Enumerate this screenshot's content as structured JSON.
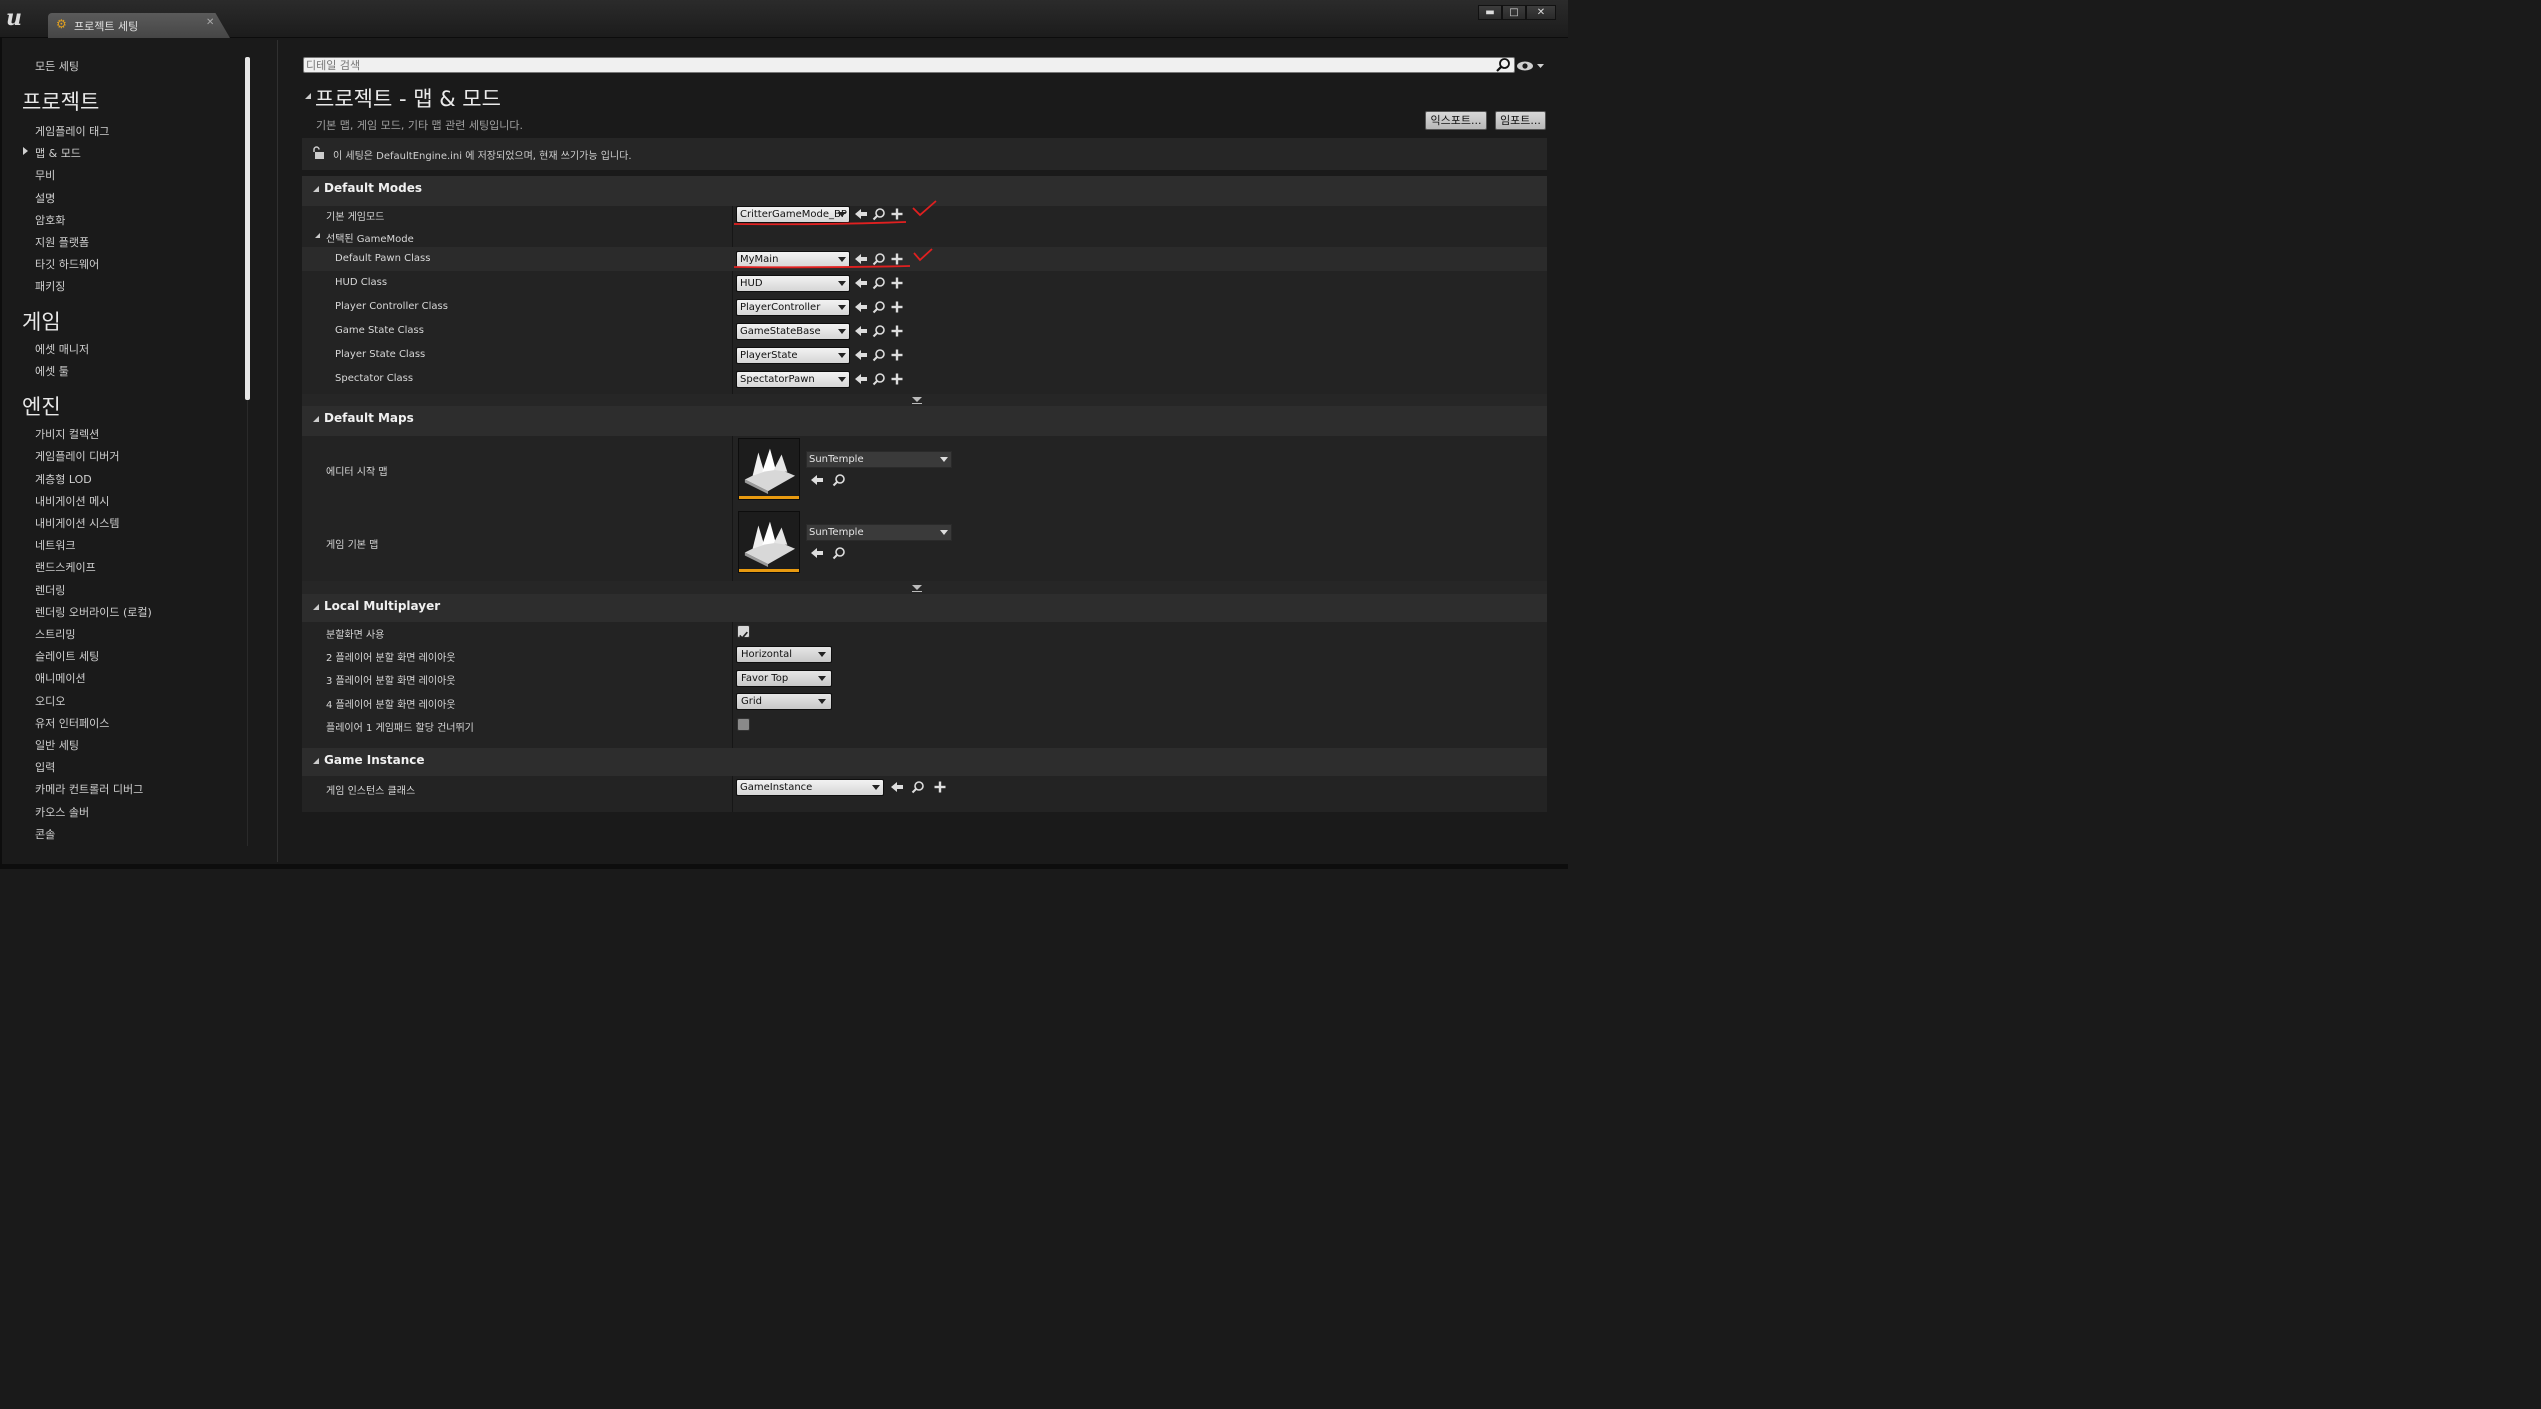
{
  "window": {
    "tab_label": "프로젝트 세팅",
    "min_label": "▬",
    "max_label": "□",
    "close_label": "✕",
    "logo": "ue-logo-icon"
  },
  "sidebar": {
    "all_settings": "모든 세팅",
    "categories": [
      {
        "title": "프로젝트",
        "items": [
          "게임플레이 태그",
          "맵 & 모드",
          "무비",
          "설명",
          "암호화",
          "지원 플랫폼",
          "타깃 하드웨어",
          "패키징"
        ]
      },
      {
        "title": "게임",
        "items": [
          "에셋 매니저",
          "에셋 툴"
        ]
      },
      {
        "title": "엔진",
        "items": [
          "가비지 컬렉션",
          "게임플레이 디버거",
          "계층형 LOD",
          "내비게이션 메시",
          "내비게이션 시스템",
          "네트워크",
          "랜드스케이프",
          "렌더링",
          "렌더링 오버라이드 (로컬)",
          "스트리밍",
          "슬레이트 세팅",
          "애니메이션",
          "오디오",
          "유저 인터페이스",
          "일반 세팅",
          "입력",
          "카메라 컨트롤러 디버그",
          "카오스 솔버",
          "콘솔"
        ]
      }
    ],
    "selected_item": "맵 & 모드"
  },
  "search": {
    "placeholder": "디테일 검색",
    "icon": "search-icon",
    "view_icon": "eye-icon"
  },
  "header": {
    "title": "프로젝트 - 맵 & 모드",
    "subtitle": "기본 맵, 게임 모드, 기타 맵 관련 세팅입니다.",
    "export_label": "익스포트...",
    "import_label": "임포트..."
  },
  "notice": {
    "text": "이 세팅은 DefaultEngine.ini 에 저장되었으며, 현재 쓰기가능 입니다.",
    "icon": "unlock-icon"
  },
  "default_modes": {
    "title": "Default Modes",
    "game_mode_label": "기본 게임모드",
    "game_mode_value": "CritterGameMode_BP",
    "selected_group": "선택된 GameMode",
    "rows": [
      {
        "label": "Default Pawn Class",
        "value": "MyMain"
      },
      {
        "label": "HUD Class",
        "value": "HUD"
      },
      {
        "label": "Player Controller Class",
        "value": "PlayerController"
      },
      {
        "label": "Game State Class",
        "value": "GameStateBase"
      },
      {
        "label": "Player State Class",
        "value": "PlayerState"
      },
      {
        "label": "Spectator Class",
        "value": "SpectatorPawn"
      }
    ]
  },
  "default_maps": {
    "title": "Default Maps",
    "rows": [
      {
        "label": "에디터 시작 맵",
        "value": "SunTemple"
      },
      {
        "label": "게임 기본 맵",
        "value": "SunTemple"
      }
    ]
  },
  "local_multiplayer": {
    "title": "Local Multiplayer",
    "splitscreen_label": "분할화면 사용",
    "splitscreen_checked": true,
    "two_player_label": "2 플레이어 분할 화면 레이아웃",
    "two_player_value": "Horizontal",
    "three_player_label": "3 플레이어 분할 화면 레이아웃",
    "three_player_value": "Favor Top",
    "four_player_label": "4 플레이어 분할 화면 레이아웃",
    "four_player_value": "Grid",
    "skip_gamepad_label": "플레이어 1 게임패드 할당 건너뛰기",
    "skip_gamepad_checked": false
  },
  "game_instance": {
    "title": "Game Instance",
    "class_label": "게임 인스턴스 클래스",
    "class_value": "GameInstance"
  },
  "colors": {
    "accent_orange": "#e89a10",
    "annotation_red": "#e02020",
    "panel": "#232323"
  }
}
